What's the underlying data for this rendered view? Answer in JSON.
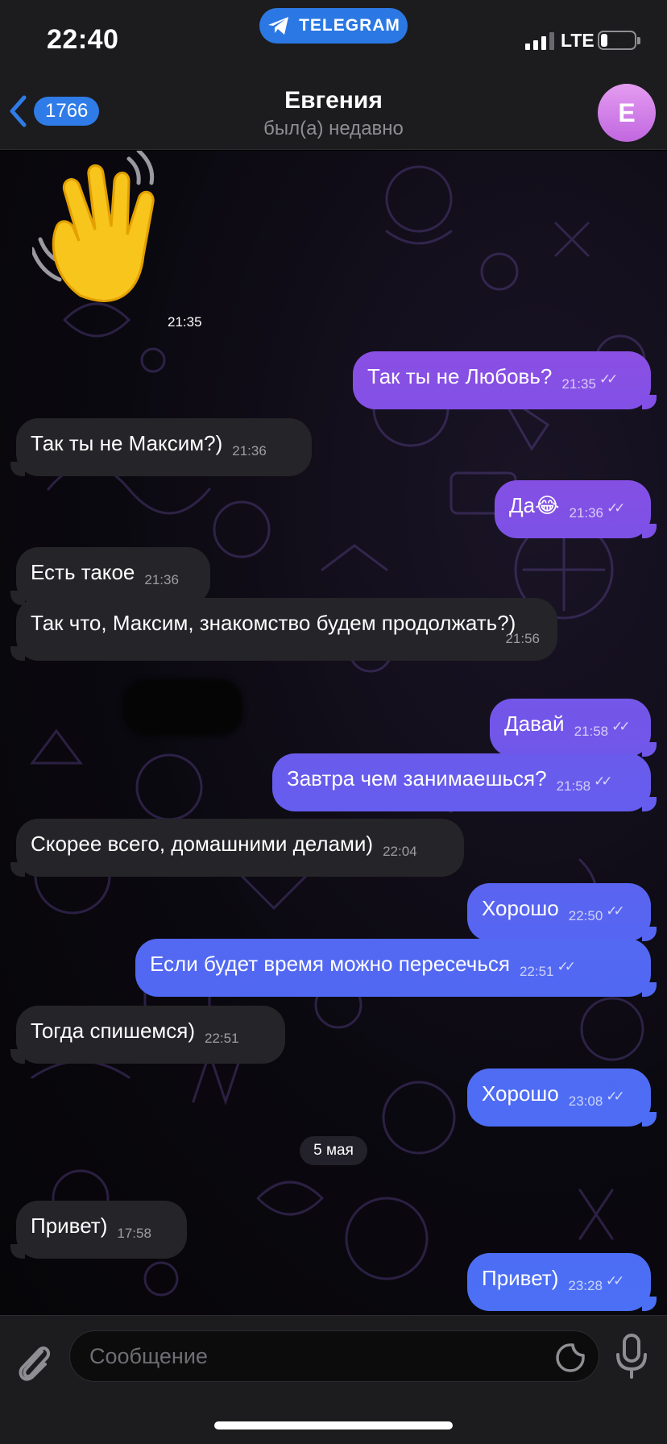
{
  "status_bar": {
    "time": "22:40",
    "banner": "TELEGRAM",
    "network": "LTE",
    "battery_level": 0.18
  },
  "header": {
    "back_count": "1766",
    "title": "Евгения",
    "subtitle": "был(а) недавно",
    "avatar_letter": "Е"
  },
  "colors": {
    "incoming_bubble": "#252428",
    "outgoing_top": "#8a4fe0",
    "outgoing_bottom": "#4f6ff0",
    "accent": "#2f7ce8"
  },
  "sticker": {
    "icon": "waving-hand-emoji",
    "time": "21:35"
  },
  "messages": [
    {
      "dir": "out",
      "text": "Так ты не Любовь?",
      "time": "21:35",
      "read": true
    },
    {
      "dir": "in",
      "text": "Так ты не Максим?)",
      "time": "21:36"
    },
    {
      "dir": "out",
      "text": "Да😂",
      "time": "21:36",
      "read": true
    },
    {
      "dir": "in",
      "text": "Есть такое",
      "time": "21:36"
    },
    {
      "dir": "in",
      "text": "Так что, Максим, знакомство будем продолжать?)",
      "time": "21:56"
    },
    {
      "dir": "out",
      "text": "Давай",
      "time": "21:58",
      "read": true
    },
    {
      "dir": "out",
      "text": "Завтра чем занимаешься?",
      "time": "21:58",
      "read": true
    },
    {
      "dir": "in",
      "text": "Скорее всего, домашними делами)",
      "time": "22:04"
    },
    {
      "dir": "out",
      "text": "Хорошо",
      "time": "22:50",
      "read": true
    },
    {
      "dir": "out",
      "text": "Если будет время можно пересечься",
      "time": "22:51",
      "read": true
    },
    {
      "dir": "in",
      "text": "Тогда спишемся)",
      "time": "22:51"
    },
    {
      "dir": "out",
      "text": "Хорошо",
      "time": "23:08",
      "read": true
    },
    {
      "dir": "in",
      "text": "Привет)",
      "time": "17:58"
    },
    {
      "dir": "out",
      "text": "Привет)",
      "time": "23:28",
      "read": true
    }
  ],
  "date_separator": "5 мая",
  "composer": {
    "placeholder": "Сообщение",
    "attach_icon": "paperclip-icon",
    "sticker_icon": "sticker-icon",
    "mic_icon": "microphone-icon"
  }
}
